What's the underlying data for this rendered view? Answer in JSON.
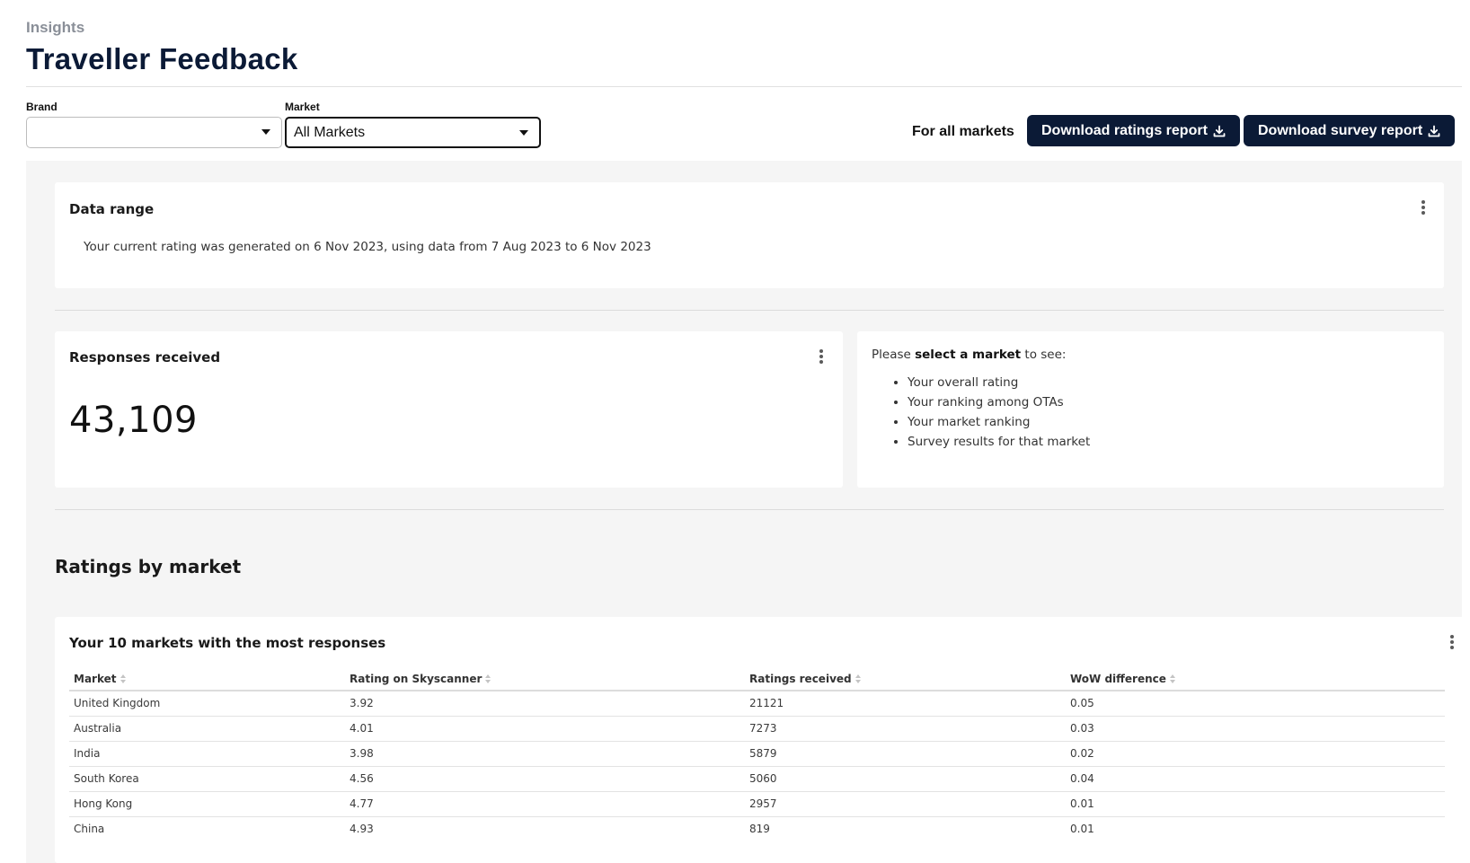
{
  "header": {
    "eyebrow": "Insights",
    "title": "Traveller Feedback"
  },
  "filters": {
    "brand": {
      "label": "Brand",
      "value": ""
    },
    "market": {
      "label": "Market",
      "value": "All Markets"
    }
  },
  "actions": {
    "scope_label": "For all markets",
    "download_ratings": "Download ratings report",
    "download_survey": "Download survey report"
  },
  "data_range": {
    "title": "Data range",
    "description": "Your current rating was generated on 6 Nov 2023, using data from 7 Aug 2023 to 6 Nov 2023"
  },
  "responses": {
    "title": "Responses received",
    "count": "43,109"
  },
  "market_prompt": {
    "prefix": "Please ",
    "bold": "select a market",
    "suffix": " to see:",
    "items": [
      "Your overall rating",
      "Your ranking among OTAs",
      "Your market ranking",
      "Survey results for that market"
    ]
  },
  "ratings_section": {
    "heading": "Ratings by market",
    "table_title": "Your 10 markets with the most responses",
    "columns": [
      "Market",
      "Rating on Skyscanner",
      "Ratings received",
      "WoW difference"
    ],
    "rows": [
      [
        "United Kingdom",
        "3.92",
        "21121",
        "0.05"
      ],
      [
        "Australia",
        "4.01",
        "7273",
        "0.03"
      ],
      [
        "India",
        "3.98",
        "5879",
        "0.02"
      ],
      [
        "South Korea",
        "4.56",
        "5060",
        "0.04"
      ],
      [
        "Hong Kong",
        "4.77",
        "2957",
        "0.01"
      ],
      [
        "China",
        "4.93",
        "819",
        "0.01"
      ]
    ]
  },
  "icons": {
    "dropdown": "caret-down-icon",
    "download": "download-icon",
    "menu": "kebab-menu-icon",
    "sort": "sort-icon"
  },
  "colors": {
    "brand_navy": "#0b1a36",
    "panel_bg": "#f5f5f5"
  }
}
